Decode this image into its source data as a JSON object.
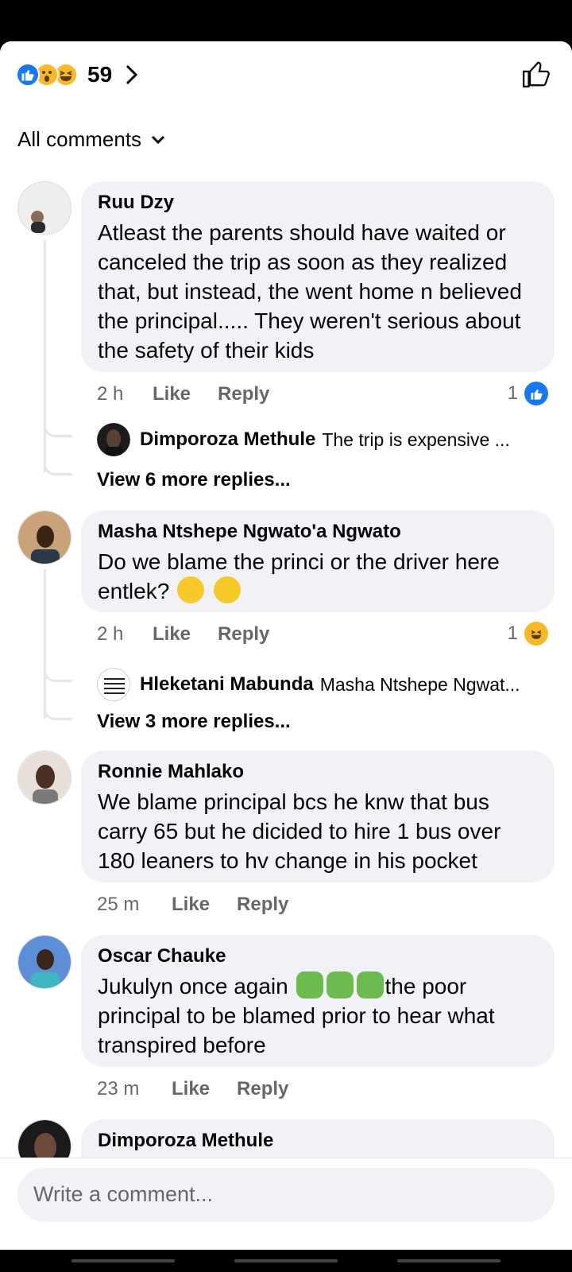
{
  "header": {
    "reaction_count": "59",
    "reactions": [
      "like-icon",
      "wow-icon",
      "haha-icon"
    ]
  },
  "filter": {
    "label": "All comments"
  },
  "comments": [
    {
      "author": "Ruu Dzy",
      "text": "Atleast the parents should have waited or canceled the trip as soon as they realized that, but instead, the went home n believed the principal..... They weren't serious about the safety of their kids",
      "time": "2 h",
      "like": "Like",
      "reply": "Reply",
      "reaction_count": "1",
      "reaction_icon": "like-icon",
      "reply_preview": {
        "author": "Dimporoza Methule",
        "snippet": "The trip is expensive ..."
      },
      "more_replies": "View 6 more replies..."
    },
    {
      "author": "Masha Ntshepe Ngwato'a Ngwato",
      "text": "Do we blame the princi or the driver here entlek?",
      "emojis": [
        "thinking-face-emoji",
        "thinking-face-emoji"
      ],
      "time": "2 h",
      "like": "Like",
      "reply": "Reply",
      "reaction_count": "1",
      "reaction_icon": "haha-icon",
      "reply_preview": {
        "author": "Hleketani Mabunda",
        "snippet": "Masha Ntshepe Ngwat...",
        "avatar_text": "AGON SENEPE AKERE LEYA NTSEP"
      },
      "more_replies": "View 3 more replies..."
    },
    {
      "author": "Ronnie Mahlako",
      "text": "We blame principal bcs he knw that bus carry 65 but he dicided to hire 1 bus over 180 leaners to hv change in his pocket",
      "time": "25 m",
      "like": "Like",
      "reply": "Reply"
    },
    {
      "author": "Oscar Chauke",
      "text_before": "Jukulyn once again",
      "emojis": [
        "person-gesturing-emoji",
        "person-gesturing-emoji",
        "person-gesturing-emoji"
      ],
      "text_after": "the poor principal to be blamed prior to hear what transpired before",
      "time": "23 m",
      "like": "Like",
      "reply": "Reply"
    },
    {
      "author": "Dimporoza Methule"
    }
  ],
  "composer": {
    "placeholder": "Write a comment..."
  },
  "colors": {
    "accent": "#1877f2",
    "bubble": "#f0f2f5",
    "muted": "#65676b",
    "haha": "#f7b928"
  }
}
